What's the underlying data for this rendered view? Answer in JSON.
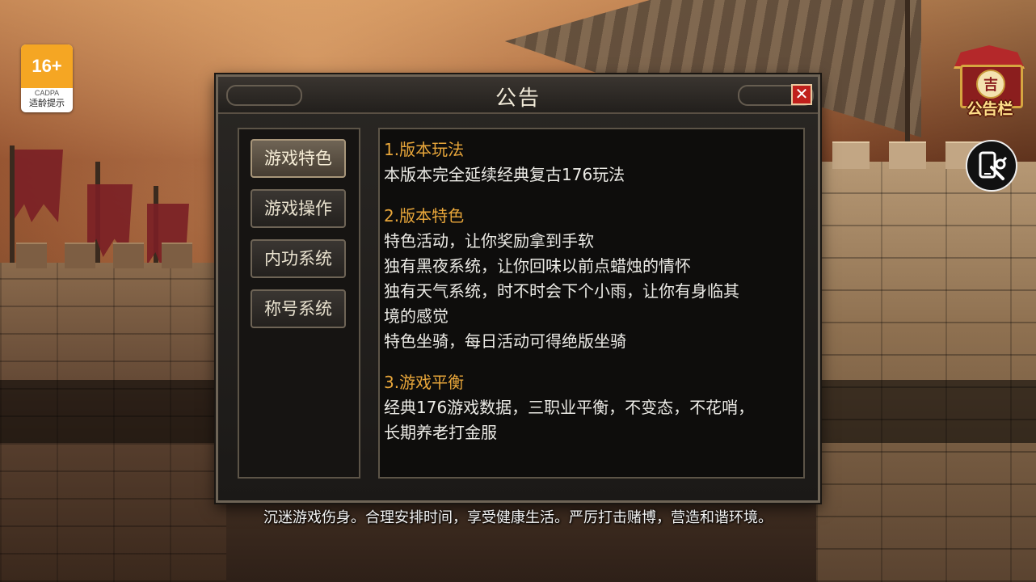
{
  "age_badge": {
    "rating": "16+",
    "org": "CADPA",
    "note": "适龄提示"
  },
  "notice_board": {
    "seal": "吉",
    "label": "公告栏"
  },
  "tool_button": {
    "icon": "phone-wrench-icon"
  },
  "dialog": {
    "title": "公告",
    "close_label": "✕",
    "tabs": [
      {
        "label": "游戏特色",
        "active": true
      },
      {
        "label": "游戏操作",
        "active": false
      },
      {
        "label": "内功系统",
        "active": false
      },
      {
        "label": "称号系统",
        "active": false
      }
    ],
    "sections": [
      {
        "title": "1.版本玩法",
        "lines": [
          "本版本完全延续经典复古176玩法"
        ]
      },
      {
        "title": "2.版本特色",
        "lines": [
          "特色活动，让你奖励拿到手软",
          "独有黑夜系统，让你回味以前点蜡烛的情怀",
          "独有天气系统，时不时会下个小雨，让你有身临其",
          "境的感觉",
          "特色坐骑，每日活动可得绝版坐骑"
        ]
      },
      {
        "title": "3.游戏平衡",
        "lines": [
          "经典176游戏数据，三职业平衡，不变态，不花哨，",
          "长期养老打金服"
        ]
      }
    ]
  },
  "health_notice": "沉迷游戏伤身。合理安排时间，享受健康生活。严厉打击赌博，营造和谐环境。",
  "colors": {
    "section_title": "#e8a63a",
    "close_button": "#c0201c",
    "age_badge": "#f5a623"
  }
}
